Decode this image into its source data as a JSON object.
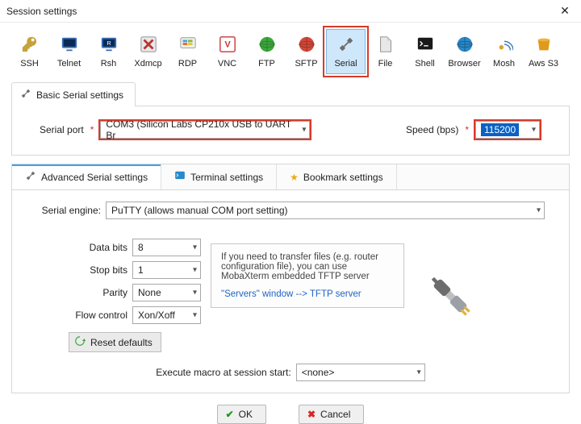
{
  "window": {
    "title": "Session settings"
  },
  "toolbar": {
    "items": [
      {
        "label": "SSH"
      },
      {
        "label": "Telnet"
      },
      {
        "label": "Rsh"
      },
      {
        "label": "Xdmcp"
      },
      {
        "label": "RDP"
      },
      {
        "label": "VNC"
      },
      {
        "label": "FTP"
      },
      {
        "label": "SFTP"
      },
      {
        "label": "Serial"
      },
      {
        "label": "File"
      },
      {
        "label": "Shell"
      },
      {
        "label": "Browser"
      },
      {
        "label": "Mosh"
      },
      {
        "label": "Aws S3"
      }
    ]
  },
  "basic": {
    "tab_label": "Basic Serial settings",
    "serial_port_label": "Serial port",
    "serial_port_value": "COM3  (Silicon Labs CP210x USB to UART Br",
    "speed_label": "Speed (bps)",
    "speed_value": "115200"
  },
  "adv": {
    "tabs": {
      "advanced": "Advanced Serial settings",
      "terminal": "Terminal settings",
      "bookmark": "Bookmark settings"
    },
    "engine_label": "Serial engine:",
    "engine_value": "PuTTY   (allows manual COM port setting)",
    "data_bits_label": "Data bits",
    "data_bits_value": "8",
    "stop_bits_label": "Stop bits",
    "stop_bits_value": "1",
    "parity_label": "Parity",
    "parity_value": "None",
    "flow_label": "Flow control",
    "flow_value": "Xon/Xoff",
    "reset_label": "Reset defaults",
    "info_line1": "If you need to transfer files (e.g. router configuration file), you can use MobaXterm embedded TFTP server",
    "info_line2": "\"Servers\" window  -->  TFTP server",
    "macro_label": "Execute macro at session start:",
    "macro_value": "<none>"
  },
  "buttons": {
    "ok": "OK",
    "cancel": "Cancel"
  }
}
